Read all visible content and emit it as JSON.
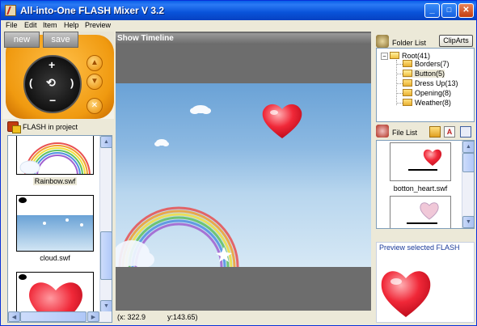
{
  "window": {
    "title": "All-into-One FLASH Mixer V 3.2",
    "controls": [
      "_",
      "□",
      "✕"
    ]
  },
  "menu": [
    "File",
    "Edit",
    "Item",
    "Help",
    "Preview"
  ],
  "controller": {
    "new_label": "new",
    "save_label": "save"
  },
  "project": {
    "header": "FLASH in project",
    "items": [
      {
        "label": "Rainbow.swf"
      },
      {
        "label": "cloud.swf"
      },
      {
        "label": ""
      }
    ]
  },
  "timeline": {
    "label": "Show Timeline"
  },
  "status": {
    "x": "(x: 322.9",
    "y": "y:143.65)"
  },
  "folders": {
    "header": "Folder List",
    "clipart_button": "ClipArts",
    "root": "Root(41)",
    "children": [
      "Borders(7)",
      "Button(5)",
      "Dress Up(13)",
      "Opening(8)",
      "Weather(8)"
    ]
  },
  "files": {
    "header": "File List",
    "items": [
      {
        "label": "botton_heart.swf"
      },
      {
        "label": ""
      }
    ]
  },
  "preview": {
    "label": "Preview selected FLASH"
  },
  "colors": {
    "titlebar": "#0a5fe8",
    "accent_orange": "#f09a10",
    "heart_red": "#e82030"
  }
}
